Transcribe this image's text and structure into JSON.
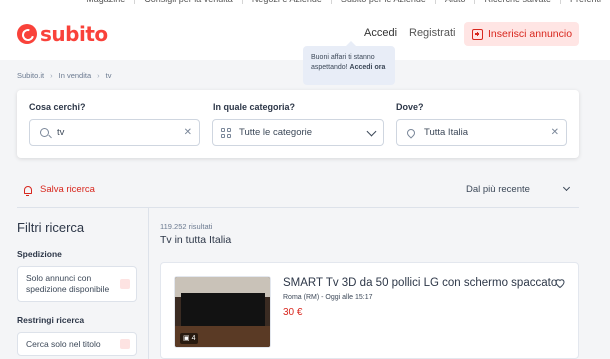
{
  "top_links": [
    "Magazine",
    "Consigli per la vendita",
    "Negozi e Aziende",
    "Subito per le Aziende",
    "Aiuto",
    "Ricerche salvate",
    "Preferiti"
  ],
  "header": {
    "logo_text": "subito",
    "login": "Accedi",
    "register": "Registrati",
    "insert_button": "Inserisci annuncio"
  },
  "tooltip": {
    "text": "Buoni affari ti stanno aspettando!",
    "link": "Accedi ora"
  },
  "breadcrumb": [
    "Subito.it",
    "In vendita",
    "tv"
  ],
  "search": {
    "what_label": "Cosa cerchi?",
    "what_value": "tv",
    "category_label": "In quale categoria?",
    "category_value": "Tutte le categorie",
    "where_label": "Dove?",
    "where_value": "Tutta Italia"
  },
  "toolbar": {
    "save_search": "Salva ricerca",
    "sort": "Dal più recente"
  },
  "filters": {
    "title": "Filtri ricerca",
    "shipping_label": "Spedizione",
    "shipping_option": "Solo annunci con spedizione disponibile",
    "restrict_label": "Restringi ricerca",
    "restrict_option": "Cerca solo nel titolo"
  },
  "results": {
    "count": "119.252 risultati",
    "title": "Tv in tutta Italia"
  },
  "listing": {
    "title": "SMART Tv 3D da 50 pollici LG con schermo spaccato",
    "meta": "Roma (RM) - Oggi alle 15:17",
    "price": "30 €",
    "photo_count": "4"
  },
  "colors": {
    "brand": "#f9423a",
    "accent_text": "#d8261d",
    "insert_bg": "#ffe5e4",
    "tooltip_bg": "#e8edf7"
  }
}
